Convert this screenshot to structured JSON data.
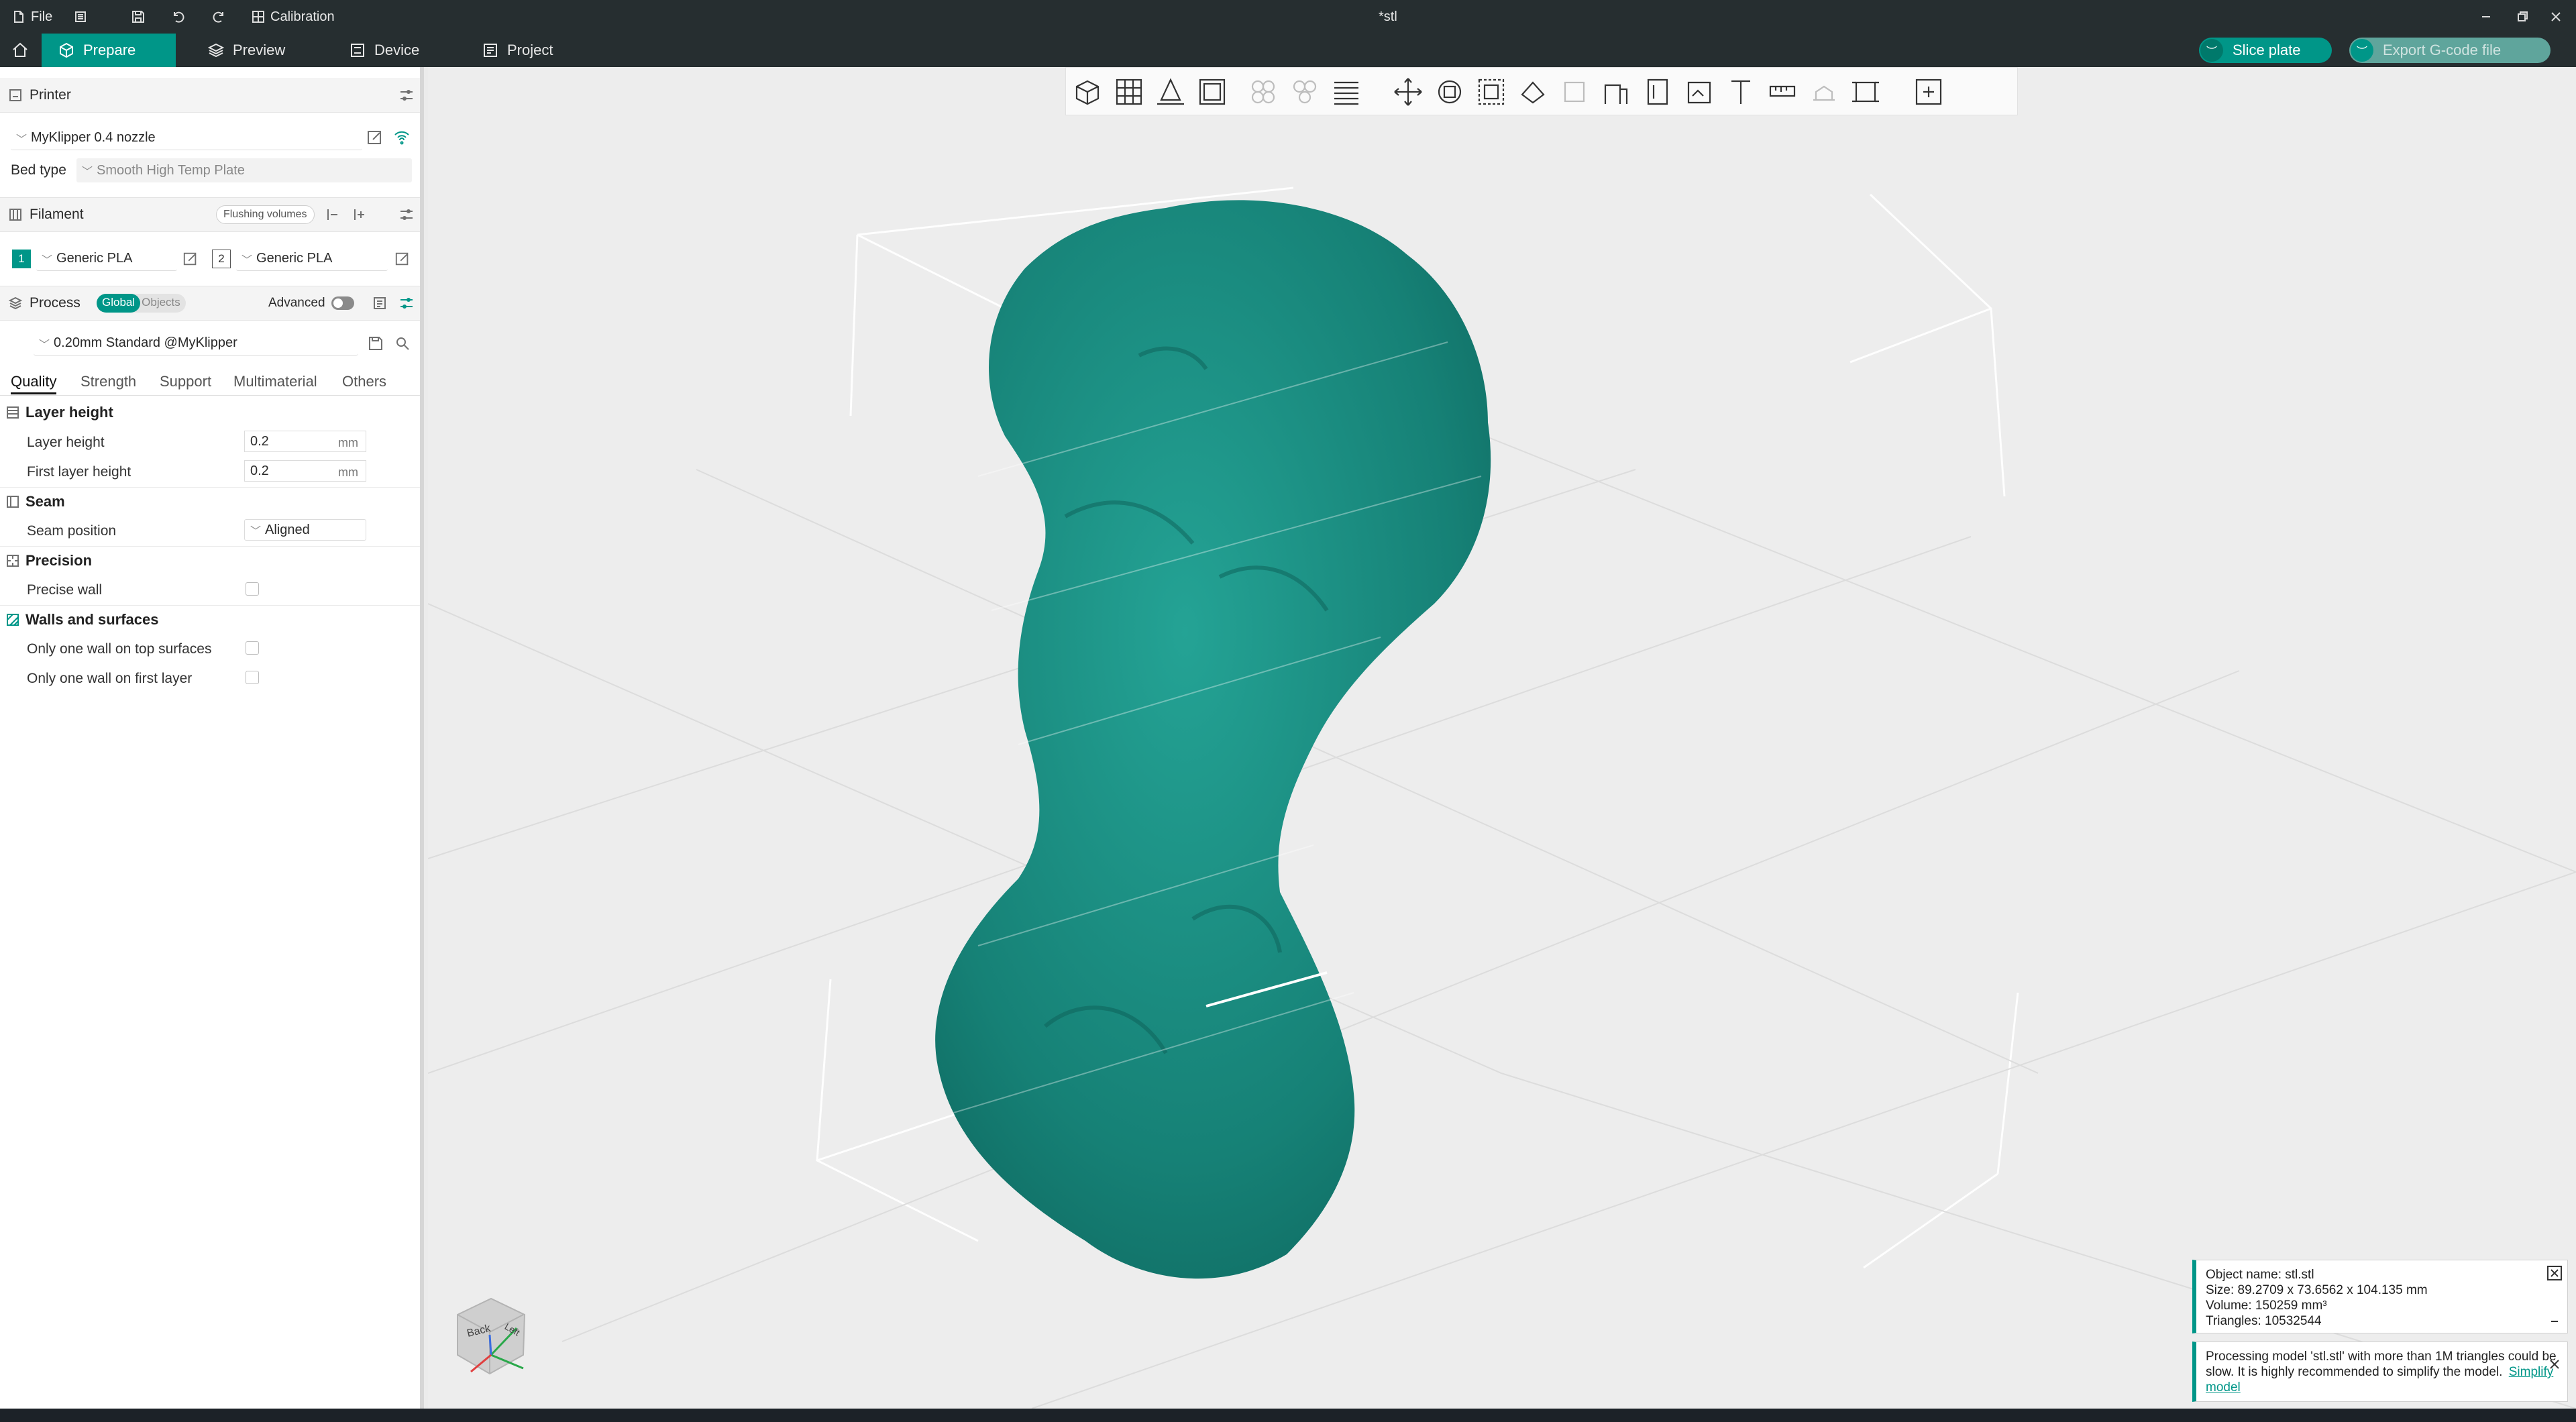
{
  "title_bar": {
    "file_label": "File",
    "calibration_label": "Calibration",
    "document_title": "*stl"
  },
  "tabs": [
    {
      "label": "Prepare",
      "icon": "cube-icon",
      "active": true
    },
    {
      "label": "Preview",
      "icon": "layers-icon",
      "active": false
    },
    {
      "label": "Device",
      "icon": "device-icon",
      "active": false
    },
    {
      "label": "Project",
      "icon": "project-icon",
      "active": false
    }
  ],
  "actions": {
    "slice_label": "Slice plate",
    "export_label": "Export G-code file"
  },
  "printer": {
    "section_label": "Printer",
    "printer_name": "MyKlipper 0.4 nozzle",
    "bed_type_label": "Bed type",
    "bed_type_value": "Smooth High Temp Plate"
  },
  "filament": {
    "section_label": "Filament",
    "flushing_label": "Flushing volumes",
    "slots": [
      {
        "index": "1",
        "name": "Generic PLA"
      },
      {
        "index": "2",
        "name": "Generic PLA"
      }
    ]
  },
  "process": {
    "section_label": "Process",
    "global_label": "Global",
    "objects_label": "Objects",
    "advanced_label": "Advanced",
    "preset": "0.20mm Standard @MyKlipper"
  },
  "settings_tabs": [
    "Quality",
    "Strength",
    "Support",
    "Multimaterial",
    "Others"
  ],
  "quality": {
    "layer_height_group": "Layer height",
    "layer_height_label": "Layer height",
    "layer_height_value": "0.2",
    "first_layer_height_label": "First layer height",
    "first_layer_height_value": "0.2",
    "unit": "mm",
    "seam_group": "Seam",
    "seam_position_label": "Seam position",
    "seam_position_value": "Aligned",
    "precision_group": "Precision",
    "precise_wall_label": "Precise wall",
    "walls_group": "Walls and surfaces",
    "one_wall_top_label": "Only one wall on top surfaces",
    "one_wall_first_label": "Only one wall on first layer"
  },
  "view_cube": {
    "back_label": "Back",
    "left_label": "Left"
  },
  "notifications": {
    "object_info": {
      "name": "Object name: stl.stl",
      "size": "Size: 89.2709 x 73.6562 x 104.135 mm",
      "volume": "Volume: 150259 mm³",
      "triangles": "Triangles: 10532544"
    },
    "warning": {
      "text": "Processing model 'stl.stl' with more than 1M triangles could be slow. It is highly recommended to simplify the model.",
      "link": "Simplify model"
    }
  },
  "colors": {
    "accent": "#009688",
    "model": "#1b8a80",
    "titlebar": "#262e30"
  }
}
